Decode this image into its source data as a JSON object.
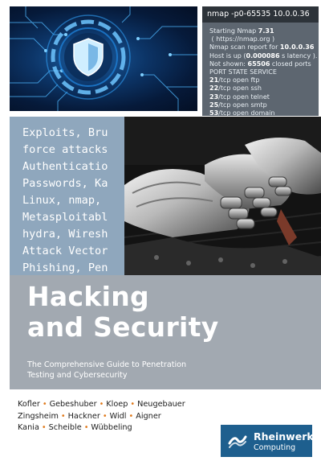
{
  "book": {
    "title_line1": "Hacking",
    "title_line2": "and Security",
    "subtitle_line1": "The Comprehensive Guide to Penetration",
    "subtitle_line2": "Testing and Cybersecurity"
  },
  "terminal": {
    "command": "nmap -p0-65535 10.0.0.36",
    "lines": [
      {
        "pre": "Starting Nmap ",
        "bold": "7.31",
        "post": ""
      },
      {
        "pre": "( https://nmap.org )",
        "bold": "",
        "post": ""
      },
      {
        "pre": "Nmap scan report for ",
        "bold": "10.0.0.36",
        "post": ""
      },
      {
        "pre": "Host is up (",
        "bold": "0.000086",
        "post": " s latency )."
      },
      {
        "pre": "Not shown: ",
        "bold": "65506",
        "post": " closed ports"
      },
      {
        "pre": "PORT STATE SERVICE",
        "bold": "",
        "post": ""
      },
      {
        "pre": "",
        "bold": "21",
        "post": "/tcp open ftp"
      },
      {
        "pre": "",
        "bold": "22",
        "post": "/tcp open ssh"
      },
      {
        "pre": "",
        "bold": "23",
        "post": "/tcp open telnet"
      },
      {
        "pre": "",
        "bold": "25",
        "post": "/tcp open smtp"
      },
      {
        "pre": "",
        "bold": "53",
        "post": "/tcp open domain"
      }
    ]
  },
  "code_panel": {
    "lines": [
      "Exploits, Bru",
      "force attacks",
      "Authenticatio",
      "Passwords, Ka",
      "Linux, nmap, ",
      "Metasploitabl",
      "hydra, Wiresh",
      "Attack Vector",
      "Phishing, Pen"
    ]
  },
  "authors": {
    "rows": [
      [
        "Kofler",
        "Gebeshuber",
        "Kloep",
        "Neugebauer"
      ],
      [
        "Zingsheim",
        "Hackner",
        "Widl",
        "Aigner"
      ],
      [
        "Kania",
        "Scheible",
        "Wübbeling"
      ]
    ],
    "separator": "•"
  },
  "publisher": {
    "name": "Rheinwerk",
    "imprint": "Computing"
  },
  "icons": {
    "shield": "shield-icon",
    "publisher_logo": "rheinwerk-logo-icon"
  },
  "colors": {
    "title_band": "#a2a9b1",
    "code_panel": "#8fa7bd",
    "terminal": "#5d6670",
    "accent_separator": "#e07a1c",
    "publisher_badge": "#1e5f8e"
  }
}
